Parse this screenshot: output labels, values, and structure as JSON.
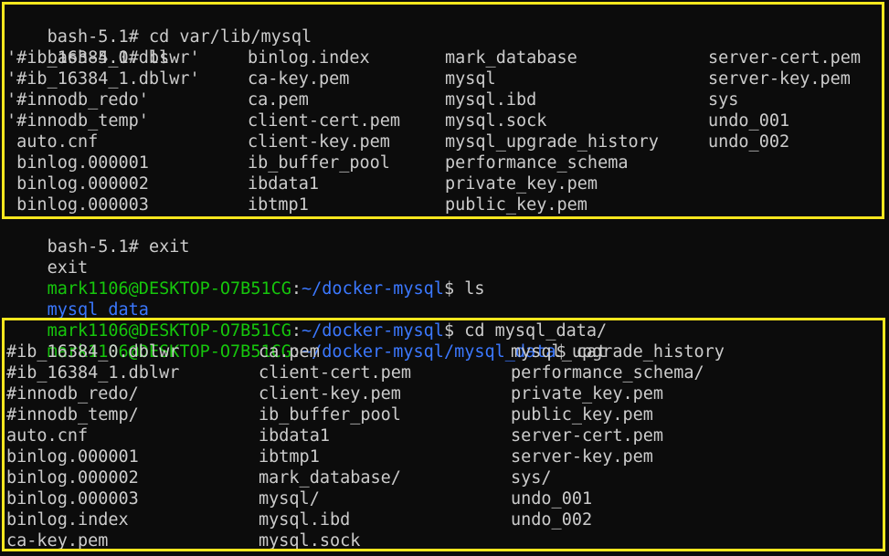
{
  "terminal": {
    "section1": {
      "cmd_cd": "bash-5.1# cd var/lib/mysql",
      "cmd_ls": "bash-5.1# ls",
      "rows": [
        [
          "'#ib_16384_0.dblwr'",
          "binlog.index",
          "mark_database",
          "server-cert.pem"
        ],
        [
          "'#ib_16384_1.dblwr'",
          "ca-key.pem",
          "mysql",
          "server-key.pem"
        ],
        [
          "'#innodb_redo'",
          "ca.pem",
          "mysql.ibd",
          "sys"
        ],
        [
          "'#innodb_temp'",
          "client-cert.pem",
          "mysql.sock",
          "undo_001"
        ],
        [
          " auto.cnf",
          "client-key.pem",
          "mysql_upgrade_history",
          "undo_002"
        ],
        [
          " binlog.000001",
          "ib_buffer_pool",
          "performance_schema",
          ""
        ],
        [
          " binlog.000002",
          "ibdata1",
          "private_key.pem",
          ""
        ],
        [
          " binlog.000003",
          "ibtmp1",
          "public_key.pem",
          ""
        ]
      ]
    },
    "middle": {
      "cmd_exit": "bash-5.1# exit",
      "exit_output": "exit",
      "prompt_user": "mark1106@DESKTOP-O7B51CG",
      "prompt_sep": ":",
      "prompt_dollar": "$",
      "path_home": "~/docker-mysql",
      "cmd_ls2": " ls",
      "ls2_output": "mysql_data",
      "cmd_cd2": " cd mysql_data/"
    },
    "section2": {
      "path": "~/docker-mysql/mysql_data",
      "cmd": " cat",
      "rows": [
        [
          "#ib_16384_0.dblwr",
          "ca.pem",
          "mysql_upgrade_history"
        ],
        [
          "#ib_16384_1.dblwr",
          "client-cert.pem",
          "performance_schema/"
        ],
        [
          "#innodb_redo/",
          "client-key.pem",
          "private_key.pem"
        ],
        [
          "#innodb_temp/",
          "ib_buffer_pool",
          "public_key.pem"
        ],
        [
          "auto.cnf",
          "ibdata1",
          "server-cert.pem"
        ],
        [
          "binlog.000001",
          "ibtmp1",
          "server-key.pem"
        ],
        [
          "binlog.000002",
          "mark_database/",
          "sys/"
        ],
        [
          "binlog.000003",
          "mysql/",
          "undo_001"
        ],
        [
          "binlog.index",
          "mysql.ibd",
          "undo_002"
        ],
        [
          "ca-key.pem",
          "mysql.sock",
          ""
        ]
      ]
    }
  },
  "colors": {
    "background": "#0c0c0c",
    "text": "#cccccc",
    "prompt_user": "#16c60c",
    "prompt_path": "#3b78ff",
    "highlight_frame": "#f9e71e"
  }
}
